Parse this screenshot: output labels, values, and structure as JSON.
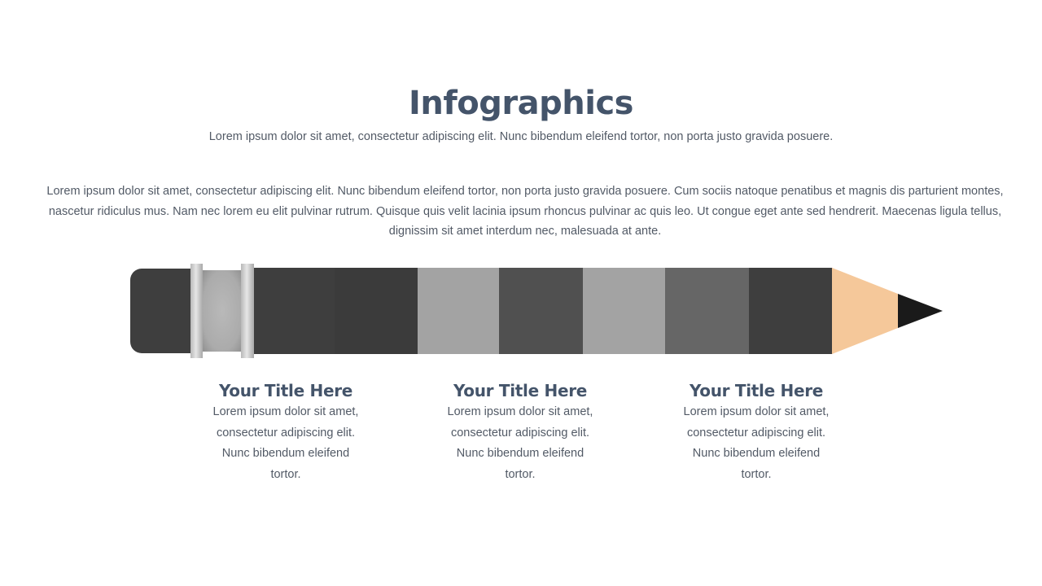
{
  "header": {
    "title": "Infographics",
    "subtitle": "Lorem ipsum dolor sit amet, consectetur adipiscing elit. Nunc bibendum eleifend tortor, non porta justo gravida posuere."
  },
  "intro": "Lorem ipsum dolor sit amet, consectetur adipiscing elit. Nunc bibendum eleifend tortor, non porta justo gravida posuere. Cum sociis natoque penatibus et magnis dis parturient montes, nascetur ridiculus mus. Nam nec lorem eu elit pulvinar rutrum. Quisque quis velit lacinia ipsum rhoncus pulvinar ac quis leo. Ut congue eget ante sed hendrerit. Maecenas ligula tellus, dignissim sit amet interdum nec, malesuada at ante.",
  "pencil": {
    "colors": {
      "eraser": "#3e3e3e",
      "ferrule_ring": "#dcdcdc",
      "ferrule_middle": "#b0b0b0",
      "wood": "#f5c89a",
      "lead": "#1a1a1a"
    },
    "segments": [
      {
        "name": "segment-1",
        "color": "#3e3e3e"
      },
      {
        "name": "segment-2",
        "color": "#3b3b3b"
      },
      {
        "name": "segment-3",
        "color": "#a3a3a3"
      },
      {
        "name": "segment-4",
        "color": "#505050"
      },
      {
        "name": "segment-5",
        "color": "#a3a3a3"
      },
      {
        "name": "segment-6",
        "color": "#666666"
      },
      {
        "name": "segment-7",
        "color": "#3e3e3e"
      }
    ]
  },
  "cards": [
    {
      "title": "Your Title Here",
      "body": [
        "Lorem ipsum dolor sit amet,",
        "consectetur adipiscing elit.",
        "Nunc bibendum eleifend",
        "tortor."
      ]
    },
    {
      "title": "Your Title Here",
      "body": [
        "Lorem ipsum dolor sit amet,",
        "consectetur adipiscing elit.",
        "Nunc bibendum eleifend",
        "tortor."
      ]
    },
    {
      "title": "Your Title Here",
      "body": [
        "Lorem ipsum dolor sit amet,",
        "consectetur adipiscing elit.",
        "Nunc bibendum eleifend",
        "tortor."
      ]
    }
  ]
}
